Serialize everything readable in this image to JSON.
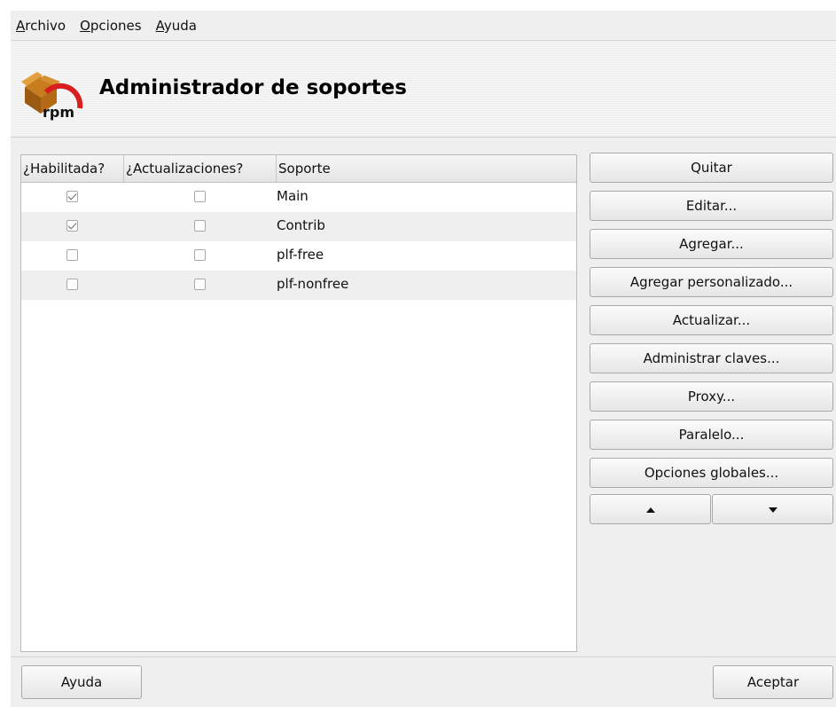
{
  "menu": {
    "items": [
      {
        "mnemonic": "A",
        "rest": "rchivo"
      },
      {
        "mnemonic": "O",
        "rest": "pciones"
      },
      {
        "mnemonic": "A",
        "rest": "yuda"
      }
    ]
  },
  "header": {
    "title": "Administrador de soportes",
    "icon_text": "rpm"
  },
  "table": {
    "columns": [
      "¿Habilitada?",
      "¿Actualizaciones?",
      "Soporte"
    ],
    "rows": [
      {
        "enabled": true,
        "updates": false,
        "name": "Main"
      },
      {
        "enabled": true,
        "updates": false,
        "name": "Contrib"
      },
      {
        "enabled": false,
        "updates": false,
        "name": "plf-free"
      },
      {
        "enabled": false,
        "updates": false,
        "name": "plf-nonfree"
      }
    ]
  },
  "actions": {
    "remove": "Quitar",
    "edit": "Editar...",
    "add": "Agregar...",
    "add_custom": "Agregar personalizado...",
    "update": "Actualizar...",
    "manage_keys": "Administrar claves...",
    "proxy": "Proxy...",
    "parallel": "Paralelo...",
    "global_options": "Opciones globales...",
    "move_up_icon": "arrow-up-icon",
    "move_down_icon": "arrow-down-icon"
  },
  "footer": {
    "help": "Ayuda",
    "ok": "Aceptar"
  },
  "colors": {
    "window_bg": "#efefef",
    "icon_red": "#d81e1e",
    "icon_brown": "#9a5a12"
  }
}
